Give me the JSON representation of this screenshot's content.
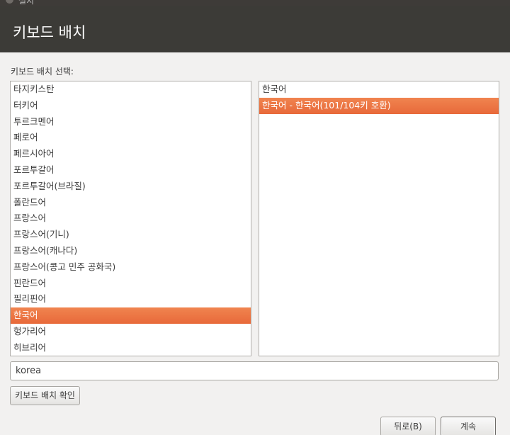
{
  "window": {
    "title": "설치"
  },
  "header": {
    "title": "키보드 배치"
  },
  "prompt": "키보드 배치 선택:",
  "layouts": [
    {
      "label": "타지키스탄",
      "selected": false
    },
    {
      "label": "터키어",
      "selected": false
    },
    {
      "label": "투르크멘어",
      "selected": false
    },
    {
      "label": "페로어",
      "selected": false
    },
    {
      "label": "페르시아어",
      "selected": false
    },
    {
      "label": "포르투갈어",
      "selected": false
    },
    {
      "label": "포르투갈어(브라질)",
      "selected": false
    },
    {
      "label": "폴란드어",
      "selected": false
    },
    {
      "label": "프랑스어",
      "selected": false
    },
    {
      "label": "프랑스어(기니)",
      "selected": false
    },
    {
      "label": "프랑스어(캐나다)",
      "selected": false
    },
    {
      "label": "프랑스어(콩고 민주 공화국)",
      "selected": false
    },
    {
      "label": "핀란드어",
      "selected": false
    },
    {
      "label": "필리핀어",
      "selected": false
    },
    {
      "label": "한국어",
      "selected": true
    },
    {
      "label": "헝가리어",
      "selected": false
    },
    {
      "label": "히브리어",
      "selected": false
    }
  ],
  "variants": [
    {
      "label": "한국어",
      "selected": false
    },
    {
      "label": "한국어 - 한국어(101/104키 호환)",
      "selected": true
    }
  ],
  "filter": {
    "value": "korea"
  },
  "buttons": {
    "detect": "키보드 배치 확인",
    "back": "뒤로(B)",
    "continue": "계속"
  },
  "colors": {
    "header": "#3c3b37",
    "selection": "#e9703e",
    "background": "#f2f1f0"
  }
}
